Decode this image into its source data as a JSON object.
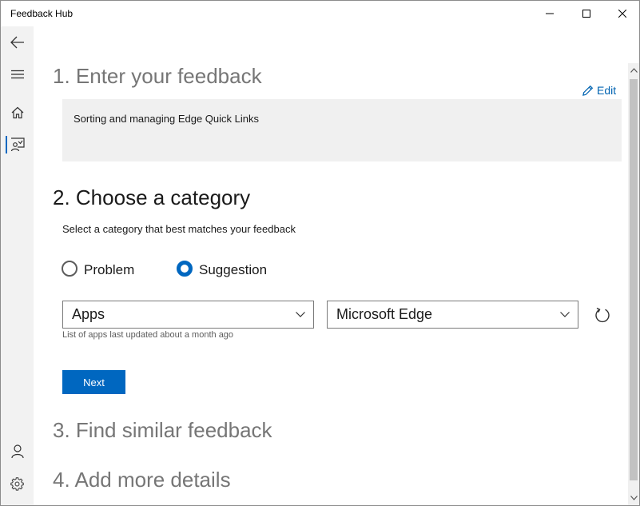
{
  "window": {
    "title": "Feedback Hub"
  },
  "nav": {
    "items": [
      {
        "icon": "back-arrow-icon"
      },
      {
        "icon": "hamburger-menu-icon"
      },
      {
        "icon": "home-icon"
      },
      {
        "icon": "feedback-icon",
        "selected": true
      },
      {
        "icon": "account-icon"
      },
      {
        "icon": "settings-gear-icon"
      }
    ]
  },
  "steps": {
    "step1_title": "1. Enter your feedback",
    "step2_title": "2. Choose a category",
    "step3_title": "3. Find similar feedback",
    "step4_title": "4. Add more details"
  },
  "feedback": {
    "edit_label": "Edit",
    "summary": "Sorting and managing Edge Quick Links"
  },
  "category": {
    "instruction": "Select a category that best matches your feedback",
    "options": [
      {
        "label": "Problem",
        "checked": false
      },
      {
        "label": "Suggestion",
        "checked": true
      }
    ],
    "primary_select": "Apps",
    "secondary_select": "Microsoft Edge",
    "hint": "List of apps last updated about a month ago",
    "next_label": "Next"
  },
  "colors": {
    "accent": "#0067c0",
    "link": "#0063b1",
    "nav_background": "#f2f2f2",
    "input_background": "#f0f0f0"
  }
}
